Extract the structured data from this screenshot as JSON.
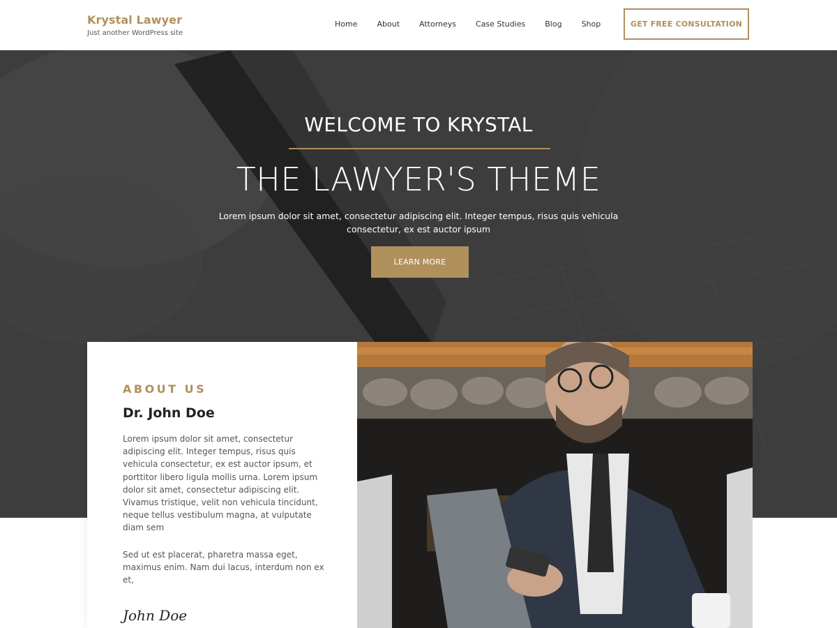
{
  "header": {
    "site_title": "Krystal Lawyer",
    "tagline": "Just another WordPress site",
    "nav": [
      "Home",
      "About",
      "Attorneys",
      "Case Studies",
      "Blog",
      "Shop"
    ],
    "cta_label": "GET FREE CONSULTATION"
  },
  "hero": {
    "welcome": "WELCOME TO KRYSTAL",
    "title": "THE LAWYER'S THEME",
    "text": "Lorem ipsum dolor sit amet, consectetur adipiscing elit. Integer tempus, risus quis vehicula consectetur, ex est auctor ipsum",
    "button_label": "LEARN MORE"
  },
  "about": {
    "label": "ABOUT US",
    "name": "Dr. John Doe",
    "paragraph1": "Lorem ipsum dolor sit amet, consectetur adipiscing elit. Integer tempus, risus quis vehicula consectetur, ex est auctor ipsum, et porttitor libero ligula mollis urna. Lorem ipsum dolor sit amet, consectetur adipiscing elit. Vivamus tristique, velit non vehicula tincidunt, neque tellus vestibulum magna, at vulputate diam sem",
    "paragraph2": "Sed ut est placerat, pharetra massa eget, maximus enim. Nam dui lacus, interdum non ex et,",
    "signature": "John Doe"
  },
  "colors": {
    "accent": "#b0905c",
    "hero_overlay": "#4a4a4a"
  }
}
